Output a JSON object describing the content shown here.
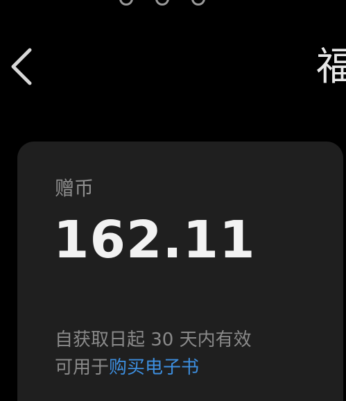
{
  "header": {
    "title": "福",
    "back_icon": "chevron-left-icon"
  },
  "card": {
    "label": "赠币",
    "balance": "162.11",
    "validity": "自获取日起 30 天内有效",
    "usage_prefix": "可用于",
    "usage_link": "购买电子书"
  },
  "colors": {
    "background": "#000000",
    "card": "#1f1f1f",
    "link": "#3d8fe0"
  }
}
